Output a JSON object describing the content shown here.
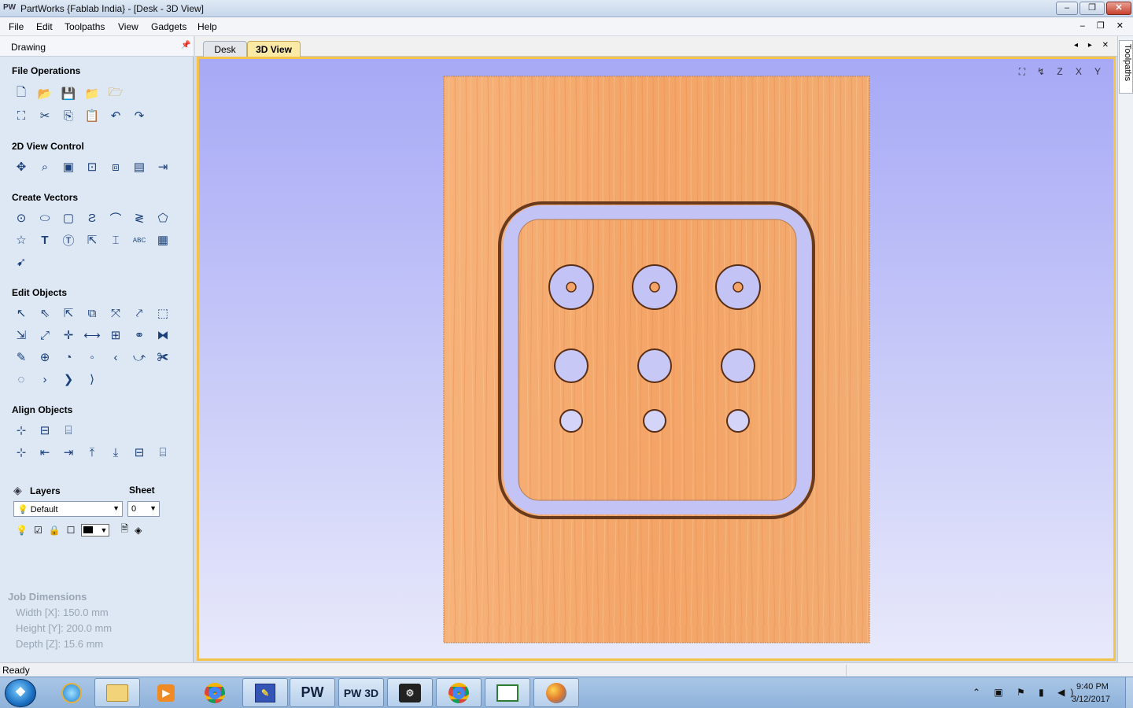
{
  "window": {
    "app_icon_text": "PW",
    "title": "PartWorks {Fablab India} - [Desk - 3D View]",
    "min_label": "–",
    "max_label": "❐",
    "close_label": "✕"
  },
  "menu": {
    "items": [
      "File",
      "Edit",
      "Toolpaths",
      "View",
      "Gadgets",
      "Help"
    ],
    "mdi_controls": "– ❐ ✕"
  },
  "left_panel": {
    "title": "Drawing",
    "pin_icon": "pin-icon",
    "sections": {
      "file_operations": "File Operations",
      "view_control_2d": "2D View Control",
      "create_vectors": "Create Vectors",
      "edit_objects": "Edit Objects",
      "align_objects": "Align Objects"
    },
    "layers": {
      "label": "Layers",
      "sheet_label": "Sheet",
      "selected_layer": "Default",
      "selected_sheet": "0",
      "color": "#000000"
    },
    "job_dimensions": {
      "title": "Job Dimensions",
      "width": "Width  [X]: 150.0 mm",
      "height": "Height [Y]: 200.0 mm",
      "depth": "Depth  [Z]: 15.6 mm"
    }
  },
  "tabs": {
    "desk": "Desk",
    "view3d": "3D View",
    "nav": "◂ ▸ ✕"
  },
  "view_tools": {
    "fit": "⛶",
    "iso": "↯",
    "z": "Z",
    "x": "X",
    "y": "Y"
  },
  "right_tab": {
    "label": "Toolpaths"
  },
  "status": {
    "text": "Ready"
  },
  "taskbar": {
    "start": "❖",
    "pw_label": "PW",
    "pw3d_label": "PW 3D",
    "tray": "⌃ ▣ ⚑ ▮ ◀)",
    "time": "9:40 PM",
    "date": "3/12/2017"
  },
  "colors": {
    "wood": "#f4a868",
    "viewport_top": "#a7a9f6",
    "viewport_bottom": "#e8e9fb",
    "tab_active": "#fbe9a6",
    "panel_bg": "#dde8f4"
  }
}
